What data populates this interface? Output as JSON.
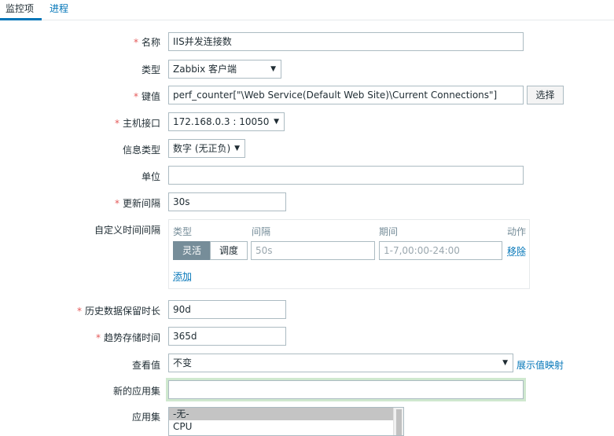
{
  "tabs": [
    {
      "label": "监控项"
    },
    {
      "label": "进程"
    }
  ],
  "form": {
    "required_mark": "*",
    "name": {
      "label": "名称",
      "value": "IIS并发连接数"
    },
    "type": {
      "label": "类型",
      "value": "Zabbix 客户端"
    },
    "key": {
      "label": "键值",
      "value": "perf_counter[\"\\Web Service(Default Web Site)\\Current Connections\"]",
      "button": "选择"
    },
    "host_interface": {
      "label": "主机接口",
      "value": "172.168.0.3 : 10050"
    },
    "info_type": {
      "label": "信息类型",
      "value": "数字 (无正负)"
    },
    "units": {
      "label": "单位",
      "value": ""
    },
    "update_interval": {
      "label": "更新间隔",
      "value": "30s"
    },
    "custom_intervals": {
      "label": "自定义时间间隔",
      "headers": {
        "type": "类型",
        "interval": "间隔",
        "period": "期间",
        "action": "动作"
      },
      "row": {
        "flexible": "灵活",
        "scheduling": "调度",
        "interval_placeholder": "50s",
        "period_placeholder": "1-7,00:00-24:00",
        "remove": "移除"
      },
      "add": "添加"
    },
    "history": {
      "label": "历史数据保留时长",
      "value": "90d"
    },
    "trends": {
      "label": "趋势存储时间",
      "value": "365d"
    },
    "show_value": {
      "label": "查看值",
      "value": "不变",
      "link": "展示值映射"
    },
    "new_application": {
      "label": "新的应用集",
      "value": ""
    },
    "applications": {
      "label": "应用集",
      "options": [
        "-无-",
        "CPU"
      ]
    }
  },
  "icons": {
    "caret": "▼"
  }
}
